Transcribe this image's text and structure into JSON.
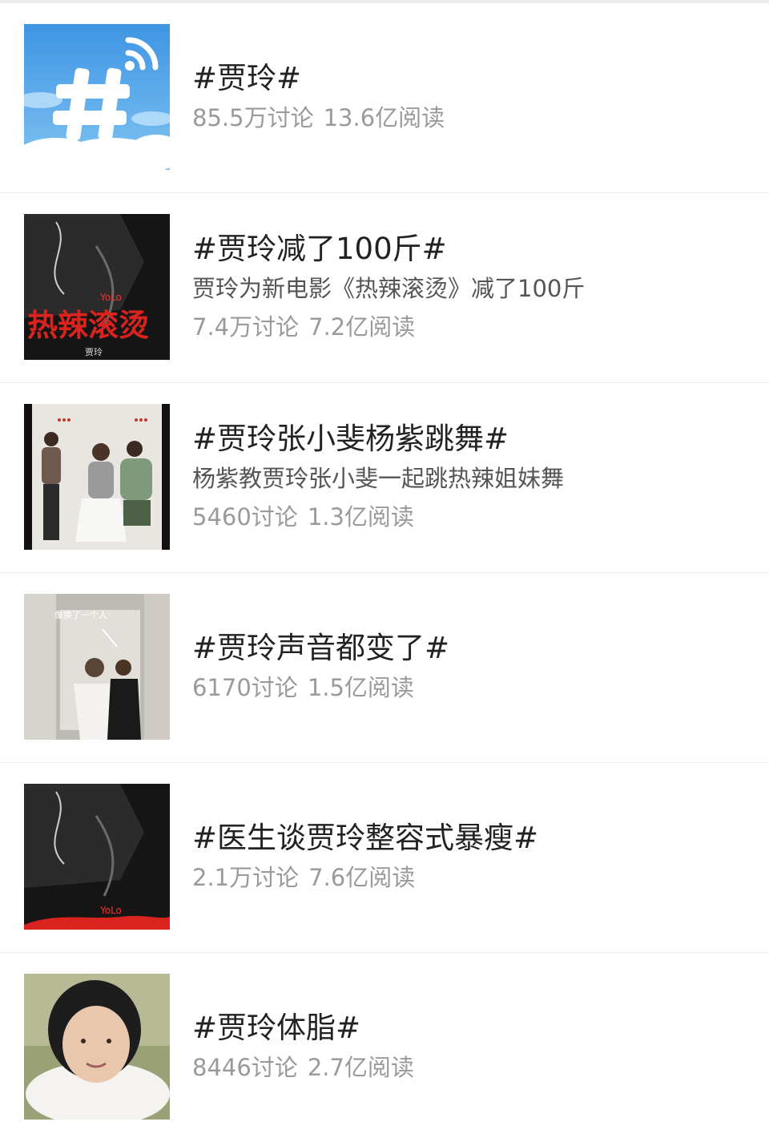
{
  "topics": [
    {
      "title": "#贾玲#",
      "description": "",
      "discussions": "85.5万讨论",
      "reads": "13.6亿阅读",
      "thumb_icon": "hashtag-wifi-icon"
    },
    {
      "title": "#贾玲减了100斤#",
      "description": "贾玲为新电影《热辣滚烫》减了100斤",
      "discussions": "7.4万讨论",
      "reads": "7.2亿阅读",
      "thumb_icon": "movie-poster-thumbnail",
      "thumb_caption": "热辣滚烫",
      "thumb_brand": "YoLo",
      "thumb_credit": "贾玲"
    },
    {
      "title": "#贾玲张小斐杨紫跳舞#",
      "description": "杨紫教贾玲张小斐一起跳热辣姐妹舞",
      "discussions": "5460讨论",
      "reads": "1.3亿阅读",
      "thumb_icon": "dance-video-thumbnail"
    },
    {
      "title": "#贾玲声音都变了#",
      "description": "",
      "discussions": "6170讨论",
      "reads": "1.5亿阅读",
      "thumb_icon": "photo-thumbnail",
      "thumb_caption": "像换了一个人"
    },
    {
      "title": "#医生谈贾玲整容式暴瘦#",
      "description": "",
      "discussions": "2.1万讨论",
      "reads": "7.6亿阅读",
      "thumb_icon": "movie-poster-thumbnail",
      "thumb_brand": "YoLo"
    },
    {
      "title": "#贾玲体脂#",
      "description": "",
      "discussions": "8446讨论",
      "reads": "2.7亿阅读",
      "thumb_icon": "portrait-thumbnail"
    }
  ],
  "colors": {
    "title": "#222222",
    "description": "#555555",
    "stats": "#9a9a9a",
    "divider": "#ededed",
    "hashtag_bg": "#4aa3e8"
  }
}
